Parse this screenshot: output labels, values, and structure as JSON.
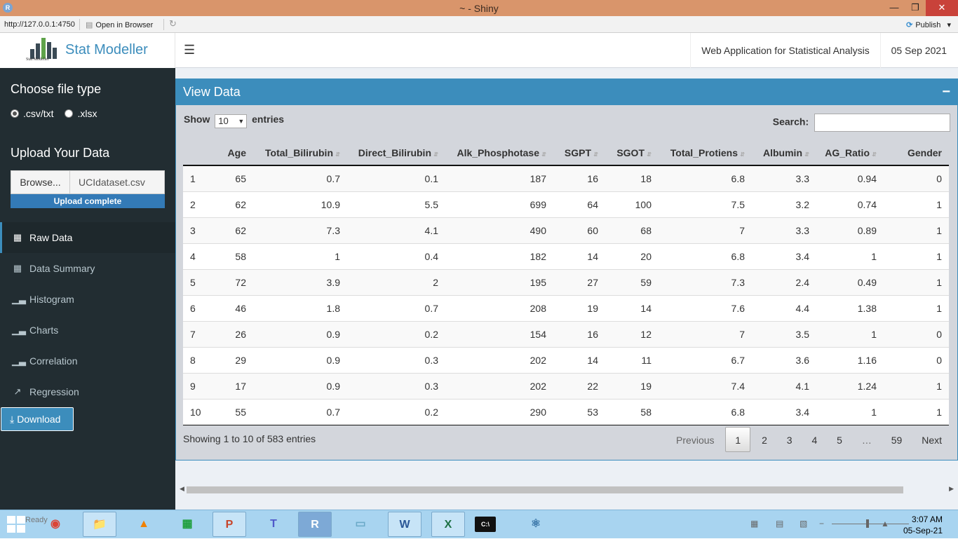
{
  "window": {
    "title": "~ - Shiny",
    "app_icon": "R",
    "min": "—",
    "restore": "❐",
    "close": "✕"
  },
  "addrbar": {
    "url": "http://127.0.0.1:4750",
    "open_in_browser": "Open in Browser",
    "publish": "Publish",
    "publish_caret": "▾"
  },
  "header": {
    "logo_caption": "Stat Modeller",
    "brand": "Stat Modeller",
    "app_name": "Web Application for Statistical Analysis",
    "date": "05 Sep 2021"
  },
  "sidebar": {
    "file_type_heading": "Choose file type",
    "file_types": [
      ".csv/txt",
      ".xlsx"
    ],
    "selected_file_type": ".csv/txt",
    "upload_heading": "Upload Your Data",
    "browse_label": "Browse...",
    "file_name": "UCIdataset.csv",
    "upload_status": "Upload complete",
    "menu": [
      {
        "label": "Raw Data",
        "icon": "table-icon"
      },
      {
        "label": "Data Summary",
        "icon": "calculator-icon"
      },
      {
        "label": "Histogram",
        "icon": "bar-chart-icon"
      },
      {
        "label": "Charts",
        "icon": "bar-chart-icon"
      },
      {
        "label": "Correlation",
        "icon": "bar-chart-icon"
      },
      {
        "label": "Regression",
        "icon": "line-chart-icon"
      }
    ],
    "active_menu": "Raw Data",
    "download_label": "Download"
  },
  "main": {
    "box_title": "View Data",
    "collapse_glyph": "−",
    "show_label": "Show",
    "entries_label": "entries",
    "page_length": "10",
    "search_label": "Search:",
    "search_value": "",
    "table": {
      "columns": [
        "",
        "Age",
        "Total_Bilirubin",
        "Direct_Bilirubin",
        "Alk_Phosphotase",
        "SGPT",
        "SGOT",
        "Total_Protiens",
        "Albumin",
        "AG_Ratio",
        "Gender"
      ],
      "rows": [
        [
          "1",
          "65",
          "0.7",
          "0.1",
          "187",
          "16",
          "18",
          "6.8",
          "3.3",
          "0.94",
          "0"
        ],
        [
          "2",
          "62",
          "10.9",
          "5.5",
          "699",
          "64",
          "100",
          "7.5",
          "3.2",
          "0.74",
          "1"
        ],
        [
          "3",
          "62",
          "7.3",
          "4.1",
          "490",
          "60",
          "68",
          "7",
          "3.3",
          "0.89",
          "1"
        ],
        [
          "4",
          "58",
          "1",
          "0.4",
          "182",
          "14",
          "20",
          "6.8",
          "3.4",
          "1",
          "1"
        ],
        [
          "5",
          "72",
          "3.9",
          "2",
          "195",
          "27",
          "59",
          "7.3",
          "2.4",
          "0.49",
          "1"
        ],
        [
          "6",
          "46",
          "1.8",
          "0.7",
          "208",
          "19",
          "14",
          "7.6",
          "4.4",
          "1.38",
          "1"
        ],
        [
          "7",
          "26",
          "0.9",
          "0.2",
          "154",
          "16",
          "12",
          "7",
          "3.5",
          "1",
          "0"
        ],
        [
          "8",
          "29",
          "0.9",
          "0.3",
          "202",
          "14",
          "11",
          "6.7",
          "3.6",
          "1.16",
          "0"
        ],
        [
          "9",
          "17",
          "0.9",
          "0.3",
          "202",
          "22",
          "19",
          "7.4",
          "4.1",
          "1.24",
          "1"
        ],
        [
          "10",
          "55",
          "0.7",
          "0.2",
          "290",
          "53",
          "58",
          "6.8",
          "3.4",
          "1",
          "1"
        ]
      ]
    },
    "info": "Showing 1 to 10 of 583 entries",
    "pager": {
      "previous": "Previous",
      "pages": [
        "1",
        "2",
        "3",
        "4",
        "5",
        "…",
        "59"
      ],
      "current": "1",
      "next": "Next"
    }
  },
  "taskbar": {
    "ready_text": "Ready",
    "apps": [
      "Chrome",
      "File Explorer",
      "VLC",
      "Store",
      "PowerPoint",
      "Teams",
      "R",
      "Notepad",
      "Word",
      "Excel",
      "Command Prompt",
      "Python"
    ],
    "time": "3:07 AM",
    "date": "05-Sep-21"
  }
}
